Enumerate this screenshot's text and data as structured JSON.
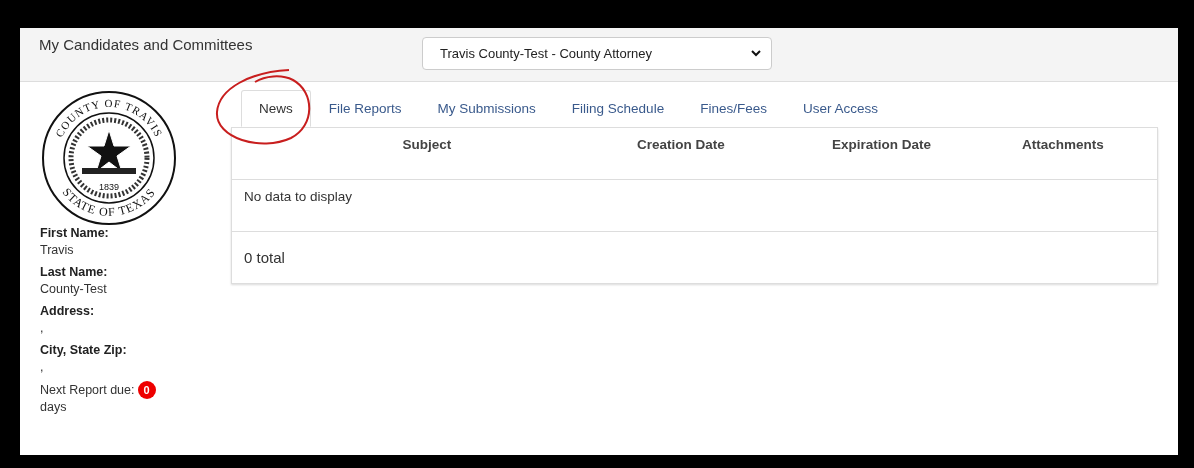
{
  "header": {
    "title": "My Candidates and Committees",
    "select": {
      "value": "Travis County-Test - County Attorney"
    }
  },
  "seal": {
    "top_text": "COUNTY OF TRAVIS",
    "bottom_text": "STATE OF TEXAS",
    "year": "1839"
  },
  "profile": [
    {
      "label": "First Name:",
      "value": "Travis"
    },
    {
      "label": "Last Name:",
      "value": "County-Test"
    },
    {
      "label": "Address:",
      "value": ","
    },
    {
      "label": "City, State Zip:",
      "value": ","
    }
  ],
  "next_report": {
    "label": "Next Report due:",
    "count": "0",
    "unit": "days"
  },
  "tabs": [
    {
      "label": "News",
      "selected": true,
      "circled": true
    },
    {
      "label": "File Reports",
      "selected": false
    },
    {
      "label": "My Submissions",
      "selected": false
    },
    {
      "label": "Filing Schedule",
      "selected": false
    },
    {
      "label": "Fines/Fees",
      "selected": false
    },
    {
      "label": "User Access",
      "selected": false
    }
  ],
  "table": {
    "columns": [
      "Subject",
      "Creation Date",
      "Expiration Date",
      "Attachments"
    ],
    "empty_text": "No data to display",
    "footer": "0 total"
  }
}
